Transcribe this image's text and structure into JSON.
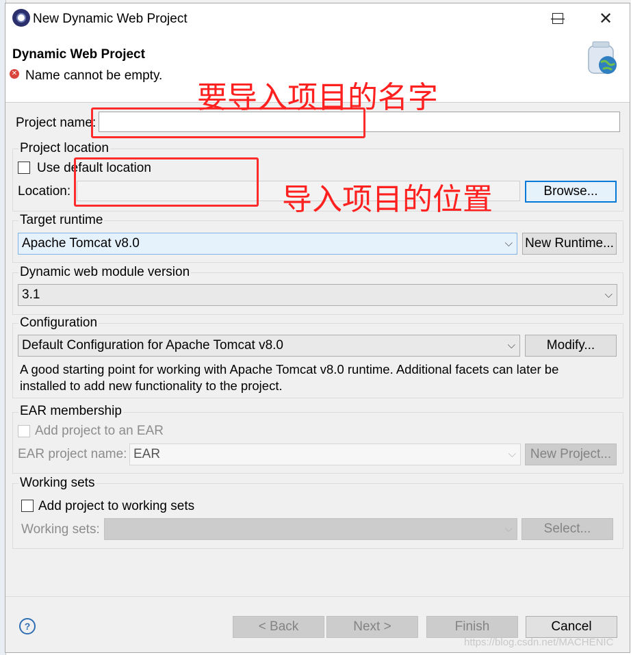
{
  "window": {
    "title": "New Dynamic Web Project",
    "minimize_icon": "minimize-icon",
    "maximize_icon": "maximize-icon",
    "close_icon": "close-icon"
  },
  "header": {
    "title": "Dynamic Web Project",
    "error_message": "Name cannot be empty.",
    "error_icon": "error-icon",
    "wizard_icon": "web-project-wizard-icon"
  },
  "project_name": {
    "label": "Project name:",
    "value": ""
  },
  "project_location": {
    "group_label": "Project location",
    "use_default_label": "Use default location",
    "use_default_checked": false,
    "location_label": "Location:",
    "location_value": "",
    "browse_button": "Browse..."
  },
  "target_runtime": {
    "group_label": "Target runtime",
    "selected": "Apache Tomcat v8.0",
    "new_runtime_button": "New Runtime..."
  },
  "module_version": {
    "group_label": "Dynamic web module version",
    "selected": "3.1"
  },
  "configuration": {
    "group_label": "Configuration",
    "selected": "Default Configuration for Apache Tomcat v8.0",
    "modify_button": "Modify...",
    "description_line1": "A good starting point for working with Apache Tomcat v8.0 runtime. Additional facets can later be",
    "description_line2": "installed to add new functionality to the project."
  },
  "ear_membership": {
    "group_label": "EAR membership",
    "add_label": "Add project to an EAR",
    "ear_name_label": "EAR project name:",
    "ear_name_value": "EAR",
    "new_project_button": "New Project..."
  },
  "working_sets": {
    "group_label": "Working sets",
    "add_label": "Add project to working sets",
    "sets_label": "Working sets:",
    "sets_value": "",
    "select_button": "Select..."
  },
  "footer": {
    "help_icon": "help-icon",
    "help_glyph": "?",
    "back_button": "< Back",
    "next_button": "Next >",
    "finish_button": "Finish",
    "cancel_button": "Cancel"
  },
  "annotations": {
    "name_note": "要导入项目的名字",
    "location_note": "导入项目的位置",
    "color": "#ff2a2a"
  },
  "watermark": "https://blog.csdn.net/MACHENIC",
  "colors": {
    "dialog_bg": "#f0f0f0",
    "focus_blue": "#0078d7",
    "selected_combo_bg": "#e5f1fb"
  }
}
